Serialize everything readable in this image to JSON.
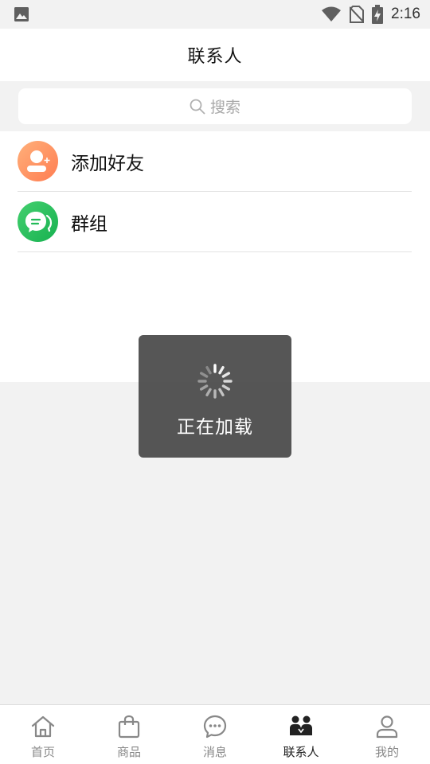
{
  "status_bar": {
    "time": "2:16",
    "icons": [
      "image-icon",
      "wifi-icon",
      "no-sim-icon",
      "battery-charging-icon"
    ]
  },
  "header": {
    "title": "联系人"
  },
  "search": {
    "placeholder": "搜索",
    "icon": "search-icon"
  },
  "list": [
    {
      "label": "添加好友",
      "icon": "add-friend-icon",
      "color": "#ff8a5c"
    },
    {
      "label": "群组",
      "icon": "group-chat-icon",
      "color": "#22bb58"
    }
  ],
  "loading": {
    "text": "正在加载"
  },
  "tabbar": {
    "items": [
      {
        "label": "首页",
        "icon": "home-icon",
        "active": false
      },
      {
        "label": "商品",
        "icon": "shopping-bag-icon",
        "active": false
      },
      {
        "label": "消息",
        "icon": "message-icon",
        "active": false
      },
      {
        "label": "联系人",
        "icon": "contacts-icon",
        "active": true
      },
      {
        "label": "我的",
        "icon": "profile-icon",
        "active": false
      }
    ]
  }
}
